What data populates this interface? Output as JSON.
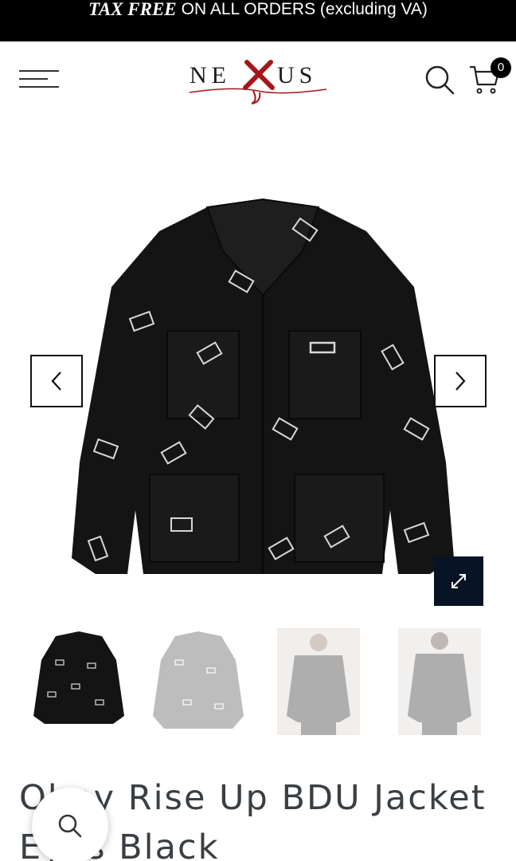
{
  "announcement": {
    "highlight": "TAX FREE",
    "text": "ON ALL ORDERS (excluding VA)"
  },
  "header": {
    "logo_text": "NEXUS",
    "cart_count": "0"
  },
  "product": {
    "title": "Obey Rise Up BDU Jacket Eyes Black"
  },
  "icons": {
    "menu": "hamburger-icon",
    "search": "search-icon",
    "cart": "cart-icon",
    "prev": "chevron-left-icon",
    "next": "chevron-right-icon",
    "zoom": "expand-icon"
  },
  "colors": {
    "announcement_bg": "#000000",
    "logo_red": "#a4161a",
    "zoom_bg": "#081325"
  }
}
